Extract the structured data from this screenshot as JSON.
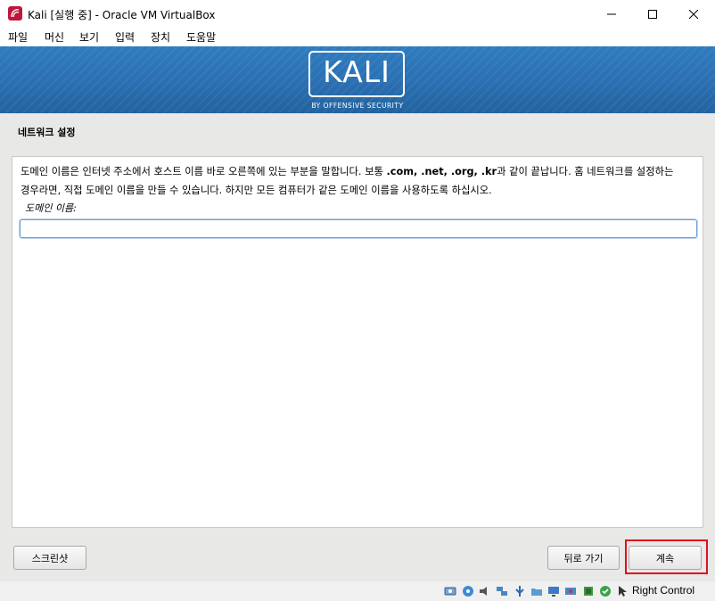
{
  "window": {
    "title": "Kali [실행 중] - Oracle VM VirtualBox",
    "icon": "virtualbox-kali-icon"
  },
  "menu": {
    "items": [
      "파일",
      "머신",
      "보기",
      "입력",
      "장치",
      "도움말"
    ]
  },
  "banner": {
    "logo_text": "KALI",
    "subtitle": "BY OFFENSIVE SECURITY"
  },
  "installer": {
    "section_title": "네트워크 설정",
    "description_before": "도메인 이름은 인터넷 주소에서 호스트 이름 바로 오른쪽에 있는 부분을 말합니다. 보통 ",
    "description_domains": ".com, .net, .org, .kr",
    "description_after": "과 같이 끝납니다. 홈 네트워크를 설정하는 경우라면, 직접 도메인 이름을 만들 수 있습니다. 하지만 모든 컴퓨터가 같은 도메인 이름을 사용하도록 하십시오.",
    "field_label": "도메인 이름:",
    "field_value": ""
  },
  "buttons": {
    "screenshot": "스크린샷",
    "back": "뒤로 가기",
    "continue": "계속"
  },
  "statusbar": {
    "host_key": "Right Control",
    "icons": [
      "hard-disk-icon",
      "optical-drive-icon",
      "audio-icon",
      "network-icon",
      "usb-icon",
      "shared-folders-icon",
      "display-icon",
      "video-capture-icon",
      "cpu-activity-icon",
      "guest-additions-icon",
      "mouse-integration-icon"
    ]
  },
  "colors": {
    "banner": "#2a6fb1",
    "highlight": "#e0101c",
    "input_focus": "#6d9fd9"
  }
}
